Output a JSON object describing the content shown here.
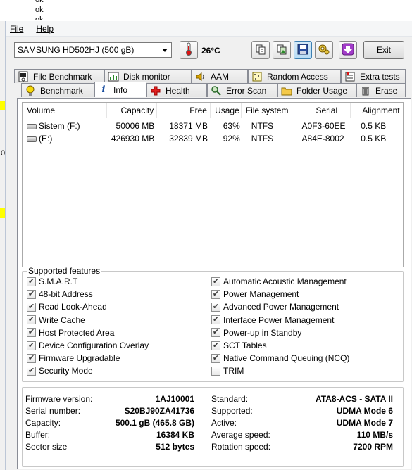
{
  "background": {
    "lines": [
      "ok",
      "ok",
      "ok"
    ],
    "left_char": "0"
  },
  "menu": {
    "file": "File",
    "help": "Help"
  },
  "toolbar": {
    "drive": "SAMSUNG HD502HJ (500 gB)",
    "temperature": "26°C",
    "exit_label": "Exit"
  },
  "tabs": {
    "file_benchmark": "File Benchmark",
    "disk_monitor": "Disk monitor",
    "aam": "AAM",
    "random_access": "Random Access",
    "extra_tests": "Extra tests",
    "benchmark": "Benchmark",
    "info": "Info",
    "health": "Health",
    "error_scan": "Error Scan",
    "folder_usage": "Folder Usage",
    "erase": "Erase"
  },
  "volumes": {
    "headers": [
      "Volume",
      "Capacity",
      "Free",
      "Usage",
      "File system",
      "Serial",
      "Alignment"
    ],
    "rows": [
      {
        "volume": "Sistem (F:)",
        "capacity": "50006 MB",
        "free": "18371 MB",
        "usage": "63%",
        "fs": "NTFS",
        "serial": "A0F3-60EE",
        "alignment": "0.5 KB"
      },
      {
        "volume": "(E:)",
        "capacity": "426930 MB",
        "free": "32839 MB",
        "usage": "92%",
        "fs": "NTFS",
        "serial": "A84E-8002",
        "alignment": "0.5 KB"
      }
    ]
  },
  "features": {
    "title": "Supported features",
    "left": [
      {
        "label": "S.M.A.R.T",
        "checked": true
      },
      {
        "label": "48-bit Address",
        "checked": true
      },
      {
        "label": "Read Look-Ahead",
        "checked": true
      },
      {
        "label": "Write Cache",
        "checked": true
      },
      {
        "label": "Host Protected Area",
        "checked": true
      },
      {
        "label": "Device Configuration Overlay",
        "checked": true
      },
      {
        "label": "Firmware Upgradable",
        "checked": true
      },
      {
        "label": "Security Mode",
        "checked": true
      }
    ],
    "right": [
      {
        "label": "Automatic Acoustic Management",
        "checked": true
      },
      {
        "label": "Power Management",
        "checked": true
      },
      {
        "label": "Advanced Power Management",
        "checked": true
      },
      {
        "label": "Interface Power Management",
        "checked": true
      },
      {
        "label": "Power-up in Standby",
        "checked": true
      },
      {
        "label": "SCT Tables",
        "checked": true
      },
      {
        "label": "Native Command Queuing (NCQ)",
        "checked": true
      },
      {
        "label": "TRIM",
        "checked": false
      }
    ]
  },
  "info": {
    "firmware_label": "Firmware version:",
    "firmware": "1AJ10001",
    "serial_label": "Serial number:",
    "serial": "S20BJ90ZA41736",
    "capacity_label": "Capacity:",
    "capacity": "500.1 gB (465.8 GB)",
    "buffer_label": "Buffer:",
    "buffer": "16384 KB",
    "sector_label": "Sector size",
    "sector": "512 bytes",
    "standard_label": "Standard:",
    "standard": "ATA8-ACS - SATA II",
    "supported_label": "Supported:",
    "supported": "UDMA Mode 6",
    "active_label": "Active:",
    "active": "UDMA Mode 7",
    "avg_speed_label": "Average speed:",
    "avg_speed": "110 MB/s",
    "rotation_label": "Rotation speed:",
    "rotation": "7200 RPM"
  },
  "colors": {
    "accent": "#3c7fb1",
    "highlight": "#ffff00"
  }
}
